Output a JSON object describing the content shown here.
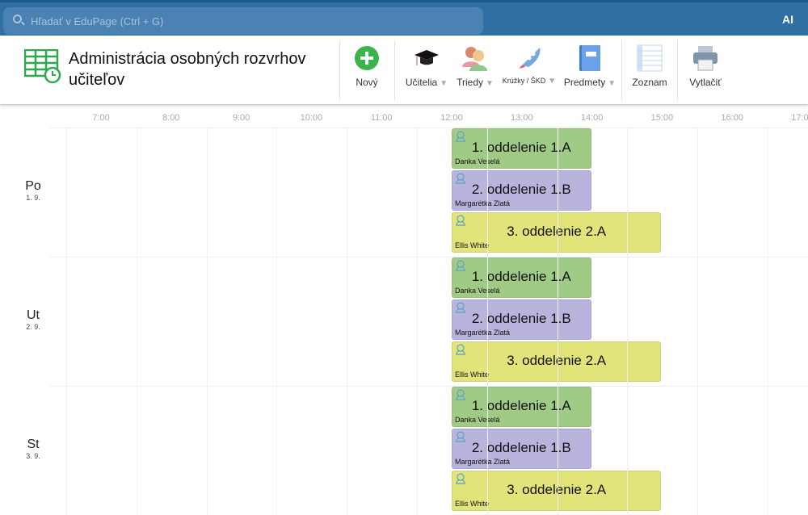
{
  "topbar": {
    "search_placeholder": "Hľadať v EduPage (Ctrl + G)",
    "ai_label": "AI"
  },
  "header": {
    "title": "Administrácia osobných rozvrhov učiteľov"
  },
  "toolbar": [
    {
      "label": "Nový",
      "icon": "plus-circle-icon",
      "dropdown": false
    },
    {
      "label": "Učitelia",
      "icon": "graduation-cap-icon",
      "dropdown": true
    },
    {
      "label": "Triedy",
      "icon": "people-icon",
      "dropdown": true
    },
    {
      "label": "Krúžky / ŠKD",
      "icon": "rocket-icon",
      "dropdown": true
    },
    {
      "label": "Predmety",
      "icon": "book-icon",
      "dropdown": true
    },
    {
      "label": "Zoznam",
      "icon": "list-icon",
      "dropdown": false
    },
    {
      "label": "Vytlačiť",
      "icon": "printer-icon",
      "dropdown": false
    }
  ],
  "hours": [
    "7:00",
    "8:00",
    "9:00",
    "10:00",
    "11:00",
    "12:00",
    "13:00",
    "14:00",
    "15:00",
    "16:00",
    "17:00"
  ],
  "colors": {
    "green": "#a0cb87",
    "purple": "#b8b4dd",
    "yellow": "#e0e47a"
  },
  "days": [
    {
      "name": "Po",
      "date": "1. 9.",
      "lessons": [
        {
          "title": "1. oddelenie 1.A",
          "teacher": "Danka Veselá",
          "start": "12:00",
          "end": "14:00",
          "color": "#a0cb87"
        },
        {
          "title": "2. oddelenie 1.B",
          "teacher": "Margarétka Zlatá",
          "start": "12:00",
          "end": "14:00",
          "color": "#b8b4dd"
        },
        {
          "title": "3. oddelenie 2.A",
          "teacher": "Ellis White",
          "start": "12:00",
          "end": "15:00",
          "color": "#e0e47a"
        }
      ]
    },
    {
      "name": "Ut",
      "date": "2. 9.",
      "lessons": [
        {
          "title": "1. oddelenie 1.A",
          "teacher": "Danka Veselá",
          "start": "12:00",
          "end": "14:00",
          "color": "#a0cb87"
        },
        {
          "title": "2. oddelenie 1.B",
          "teacher": "Margarétka Zlatá",
          "start": "12:00",
          "end": "14:00",
          "color": "#b8b4dd"
        },
        {
          "title": "3. oddelenie 2.A",
          "teacher": "Ellis White",
          "start": "12:00",
          "end": "15:00",
          "color": "#e0e47a"
        }
      ]
    },
    {
      "name": "St",
      "date": "3. 9.",
      "lessons": [
        {
          "title": "1. oddelenie 1.A",
          "teacher": "Danka Veselá",
          "start": "12:00",
          "end": "14:00",
          "color": "#a0cb87"
        },
        {
          "title": "2. oddelenie 1.B",
          "teacher": "Margarétka Zlatá",
          "start": "12:00",
          "end": "14:00",
          "color": "#b8b4dd"
        },
        {
          "title": "3. oddelenie 2.A",
          "teacher": "Ellis White",
          "start": "12:00",
          "end": "15:00",
          "color": "#e0e47a"
        }
      ]
    }
  ]
}
